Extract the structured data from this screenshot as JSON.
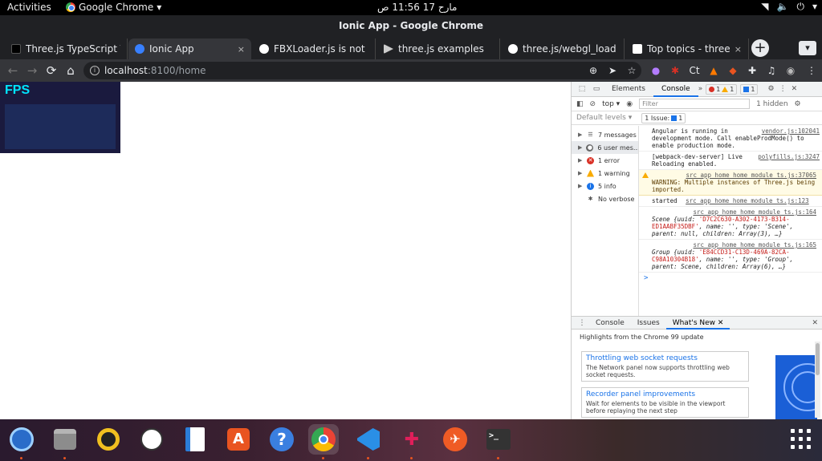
{
  "topbar": {
    "activities": "Activities",
    "app_name": "Google Chrome",
    "clock": "مارح 17  11:56 ص"
  },
  "window": {
    "title": "Ionic App - Google Chrome"
  },
  "tabs": [
    {
      "label": "Three.js TypeScript T",
      "favicon_color": "#000000"
    },
    {
      "label": "Ionic App",
      "favicon_color": "#3880ff"
    },
    {
      "label": "FBXLoader.js is not l",
      "favicon_color": "#ffffff"
    },
    {
      "label": "three.js examples",
      "favicon_color": "#cccccc"
    },
    {
      "label": "three.js/webgl_load",
      "favicon_color": "#ffffff"
    },
    {
      "label": "Top topics - three.js",
      "favicon_color": "#ffffff"
    }
  ],
  "tab_close_glyph": "×",
  "toolbar": {
    "url_host": "localhost",
    "url_rest": ":8100/home"
  },
  "page": {
    "fps_label": "FPS"
  },
  "devtools": {
    "tabs": {
      "elements": "Elements",
      "console": "Console"
    },
    "error_count": "1",
    "warning_count": "1",
    "info_count": "1",
    "context": "top",
    "filter_placeholder": "Filter",
    "hidden": "1 hidden",
    "default_levels": "Default levels",
    "issues": "1 Issue:",
    "issues_count": "1",
    "sidebar": [
      {
        "label": "7 messages",
        "icon": "list-icon"
      },
      {
        "label": "6 user mes...",
        "icon": "user-icon"
      },
      {
        "label": "1 error",
        "icon": "error-icon",
        "color": "#d93025"
      },
      {
        "label": "1 warning",
        "icon": "warning-icon",
        "color": "#f9ab00"
      },
      {
        "label": "5 info",
        "icon": "info-icon",
        "color": "#1a73e8"
      },
      {
        "label": "No verbose",
        "icon": "bug-icon"
      }
    ],
    "console": {
      "m1_src": "vendor.js:102041",
      "m1_text": "Angular is running in development mode. Call enableProdMode() to enable production mode.",
      "m2_src": "polyfills.js:3247",
      "m2_text": "[webpack-dev-server] Live Reloading enabled.",
      "m3_src": "src_app_home_home_module_ts.js:37065",
      "m3_text": "WARNING: Multiple instances of Three.js being imported.",
      "m4_text": "started",
      "m4_src": "src_app_home_home_module_ts.js:123",
      "m5_src": "src_app_home_home_module_ts.js:164",
      "m5_obj": "Scene {uuid: ",
      "m5_uuid": "'D7C2C630-A302-4173-B314-ED1AABF35DBF'",
      "m5_rest": ", name: '', type: 'Scene', parent: null, children: Array(3), …}",
      "m6_src": "src_app_home_home_module_ts.js:165",
      "m6_obj": "Group {uuid: ",
      "m6_uuid": "'E84CCD31-C13D-469A-82CA-C98A10304B18'",
      "m6_rest": ", name: '', type: 'Group', parent: Scene, children: Array(6), …}",
      "prompt": ">"
    },
    "drawer_tabs": {
      "console": "Console",
      "issues": "Issues",
      "whats_new": "What's New"
    },
    "drawer": {
      "highlights": "Highlights from the Chrome 99 update",
      "cards": [
        {
          "title": "Throttling web socket requests",
          "desc": "The Network panel now supports throttling web socket requests."
        },
        {
          "title": "Recorder panel improvements",
          "desc": "Wait for elements to be visible in the viewport before replaying the next step"
        }
      ]
    }
  },
  "dock": [
    {
      "icon": "thunderbird-icon",
      "color": "#2a6cc9"
    },
    {
      "icon": "files-icon",
      "color": "#8c8c8c"
    },
    {
      "icon": "rhythmbox-icon",
      "color": "#f0c020"
    },
    {
      "icon": "inkscape-icon",
      "color": "#ffffff"
    },
    {
      "icon": "libreoffice-writer-icon",
      "color": "#2b7dd8"
    },
    {
      "icon": "software-center-icon",
      "color": "#e95420"
    },
    {
      "icon": "help-icon",
      "color": "#3a7fe0"
    },
    {
      "icon": "chrome-icon",
      "color": "#4285f4"
    },
    {
      "icon": "vscode-icon",
      "color": "#2a8fe6"
    },
    {
      "icon": "slack-icon",
      "color": "#ffffff"
    },
    {
      "icon": "postman-icon",
      "color": "#ef5b25"
    },
    {
      "icon": "terminal-icon",
      "color": "#333333"
    }
  ]
}
